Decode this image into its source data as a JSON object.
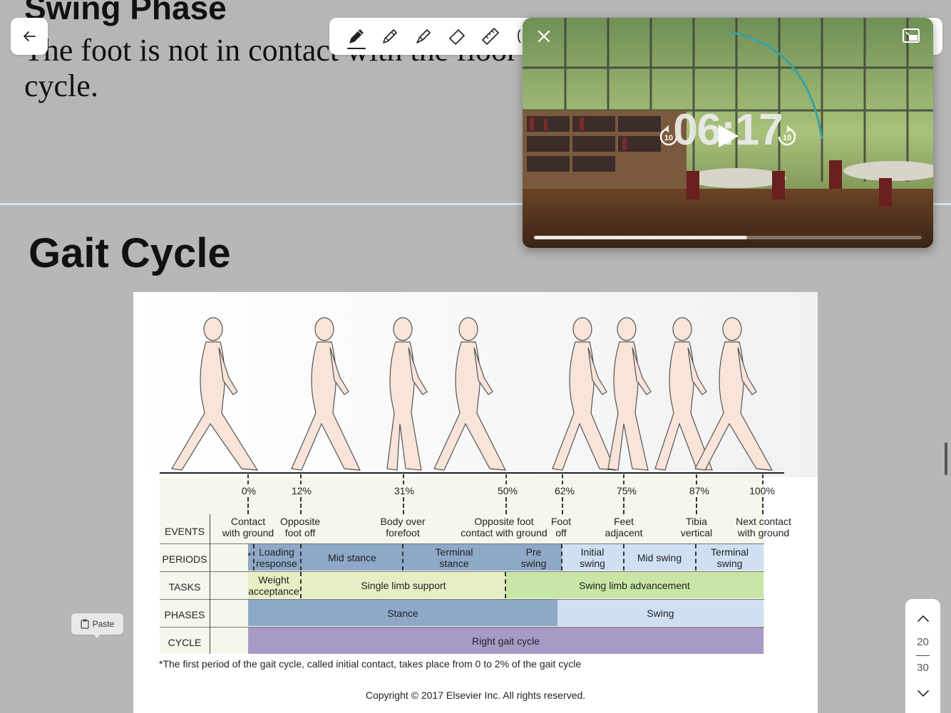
{
  "top_slide": {
    "title": "Swing Phase",
    "body": "The foot is not in contact with the floor",
    "body_line2": "cycle."
  },
  "section_title": "Gait Cycle",
  "toolbar": {
    "tools": [
      "pen-icon",
      "pencil-icon",
      "highlighter-icon",
      "eraser-icon",
      "ruler-icon",
      "lasso-icon"
    ],
    "selected_tool": "pen-icon"
  },
  "video": {
    "timer": "06:17",
    "skip_back": "10",
    "skip_forward": "10",
    "progress": 0.55
  },
  "gait_diagram": {
    "percentages": [
      "0%",
      "12%",
      "31%",
      "50%",
      "62%",
      "75%",
      "87%",
      "100%"
    ],
    "events": [
      {
        "l1": "Contact",
        "l2": "with ground"
      },
      {
        "l1": "Opposite",
        "l2": "foot off"
      },
      {
        "l1": "Body over",
        "l2": "forefoot"
      },
      {
        "l1": "Opposite foot",
        "l2": "contact with ground"
      },
      {
        "l1": "Foot",
        "l2": "off"
      },
      {
        "l1": "Feet",
        "l2": "adjacent"
      },
      {
        "l1": "Tibia",
        "l2": "vertical"
      },
      {
        "l1": "Next contact",
        "l2": "with ground"
      }
    ],
    "row_labels": {
      "events": "EVENTS",
      "periods": "PERIODS",
      "tasks": "TASKS",
      "phases": "PHASES",
      "cycle": "CYCLE"
    },
    "periods": [
      {
        "l1": "Loading",
        "l2": "response"
      },
      {
        "l1": "Mid stance",
        "l2": ""
      },
      {
        "l1": "Terminal",
        "l2": "stance"
      },
      {
        "l1": "Pre",
        "l2": "swing"
      },
      {
        "l1": "Initial",
        "l2": "swing"
      },
      {
        "l1": "Mid swing",
        "l2": ""
      },
      {
        "l1": "Terminal",
        "l2": "swing"
      }
    ],
    "period_marker": "*",
    "tasks": [
      {
        "l1": "Weight",
        "l2": "acceptance"
      },
      {
        "l1": "Single limb support",
        "l2": ""
      },
      {
        "l1": "Swing limb advancement",
        "l2": ""
      }
    ],
    "phases": [
      "Stance",
      "Swing"
    ],
    "cycle": "Right gait cycle",
    "footnote": "*The first period of the gait cycle, called initial contact, takes place from 0 to 2% of the gait cycle",
    "copyright": "Copyright © 2017 Elsevier Inc. All rights reserved.",
    "colors": {
      "stance_dark": "#8ea8c8",
      "swing_light": "#cfe0f2",
      "task_yellow": "#e6efc4",
      "task_green": "#c8e6a6",
      "cycle_purple": "#a79ac6",
      "background": "#f4f7ec"
    }
  },
  "paste_label": "Paste",
  "page_nav": {
    "current": "20",
    "total": "30"
  }
}
